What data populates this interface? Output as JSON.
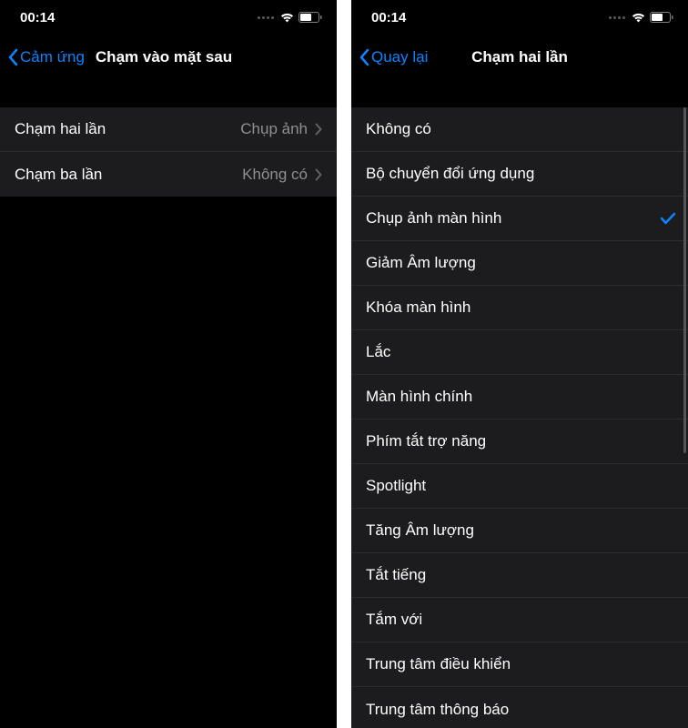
{
  "left": {
    "time": "00:14",
    "back_label": "Cảm ứng",
    "title": "Chạm vào mặt sau",
    "rows": [
      {
        "label": "Chạm hai lần",
        "value": "Chụp ảnh"
      },
      {
        "label": "Chạm ba lần",
        "value": "Không có"
      }
    ]
  },
  "right": {
    "time": "00:14",
    "back_label": "Quay lại",
    "title": "Chạm hai lần",
    "options": [
      {
        "label": "Không có",
        "selected": false
      },
      {
        "label": "Bộ chuyển đổi ứng dụng",
        "selected": false
      },
      {
        "label": "Chụp ảnh màn hình",
        "selected": true
      },
      {
        "label": "Giảm Âm lượng",
        "selected": false
      },
      {
        "label": "Khóa màn hình",
        "selected": false
      },
      {
        "label": "Lắc",
        "selected": false
      },
      {
        "label": "Màn hình chính",
        "selected": false
      },
      {
        "label": "Phím tắt trợ năng",
        "selected": false
      },
      {
        "label": "Spotlight",
        "selected": false
      },
      {
        "label": "Tăng Âm lượng",
        "selected": false
      },
      {
        "label": "Tắt tiếng",
        "selected": false
      },
      {
        "label": "Tắm với",
        "selected": false
      },
      {
        "label": "Trung tâm điều khiển",
        "selected": false
      },
      {
        "label": "Trung tâm thông báo",
        "selected": false
      }
    ]
  }
}
